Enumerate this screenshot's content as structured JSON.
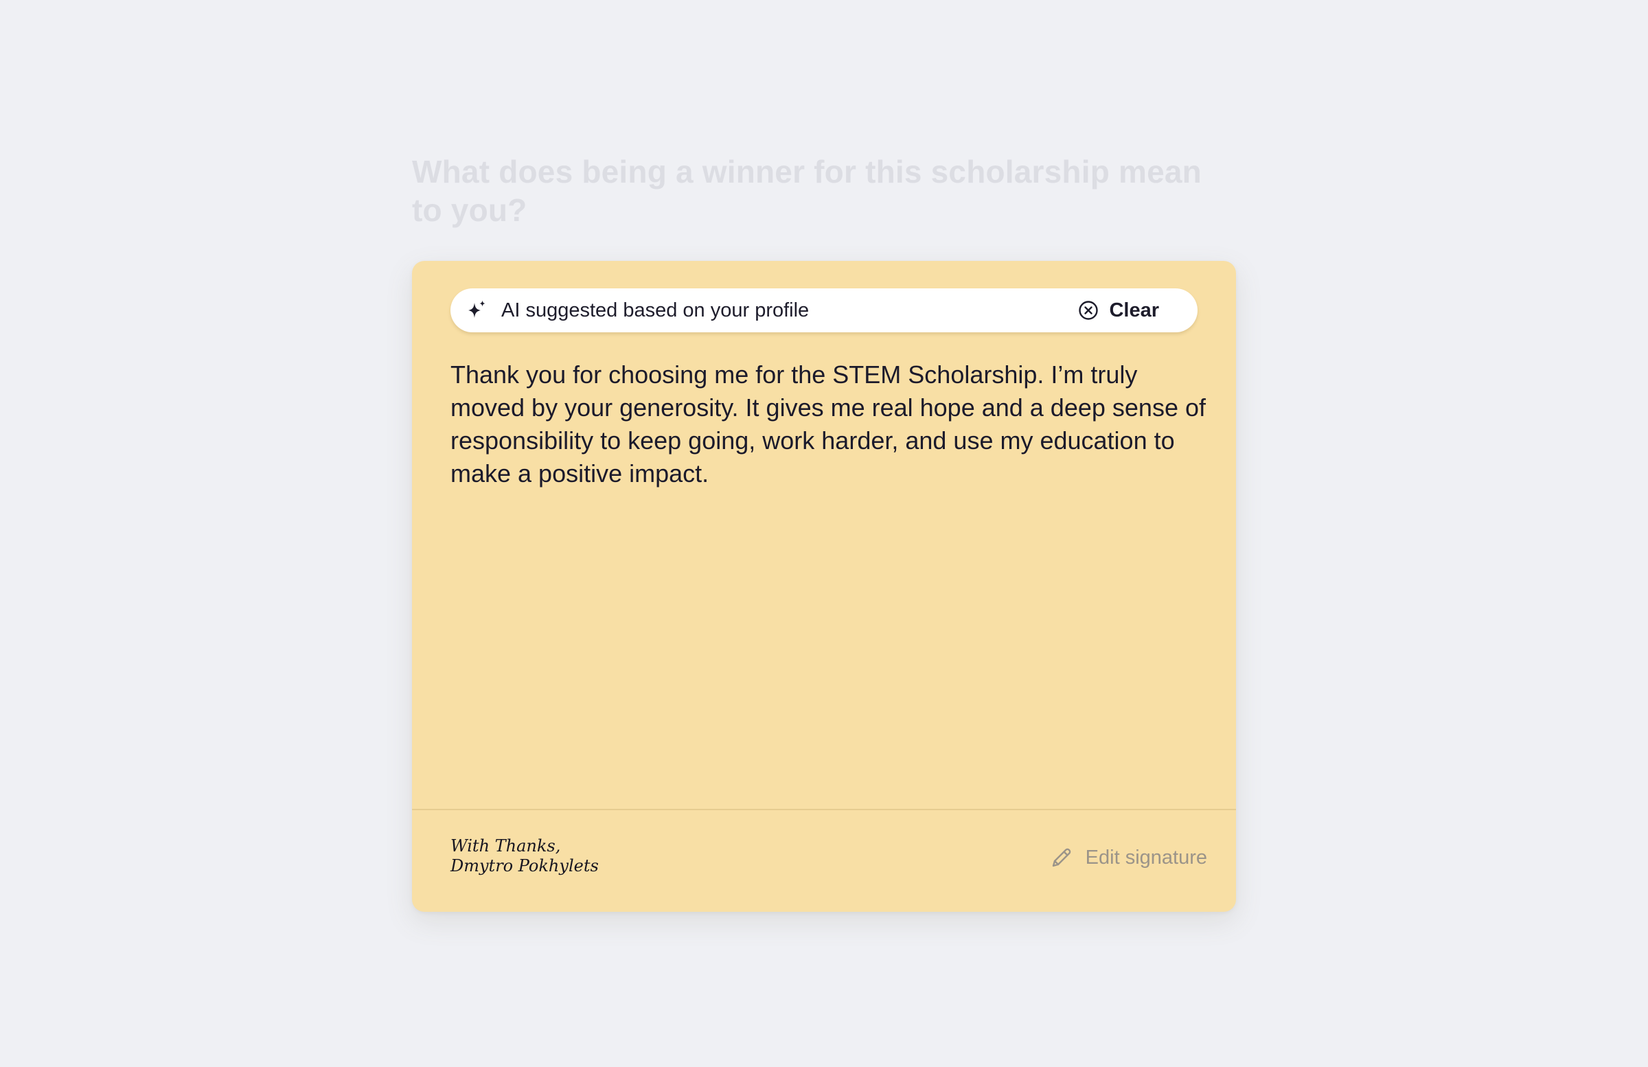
{
  "question": {
    "title": "What does being a winner for this scholarship mean to you?"
  },
  "card": {
    "ai_banner": {
      "label": "AI suggested based on your profile",
      "icon": "sparkle-icon",
      "clear_label": "Clear",
      "clear_icon": "close-circle-icon"
    },
    "message": "Thank you for choosing me for the STEM Scholarship. I’m truly moved by your generosity. It gives me real hope and a deep sense of responsibility to keep going, work harder, and use my education to make a positive impact.",
    "signature": {
      "line1": "With Thanks,",
      "line2": "Dmytro Pokhylets"
    },
    "edit_signature": {
      "label": "Edit signature",
      "icon": "pencil-icon"
    }
  },
  "colors": {
    "page_background": "#eff0f4",
    "card_background": "#f8dfa5",
    "question_text": "#dcdde3",
    "body_text": "#1b1a2b",
    "muted_text": "#9b9489"
  }
}
